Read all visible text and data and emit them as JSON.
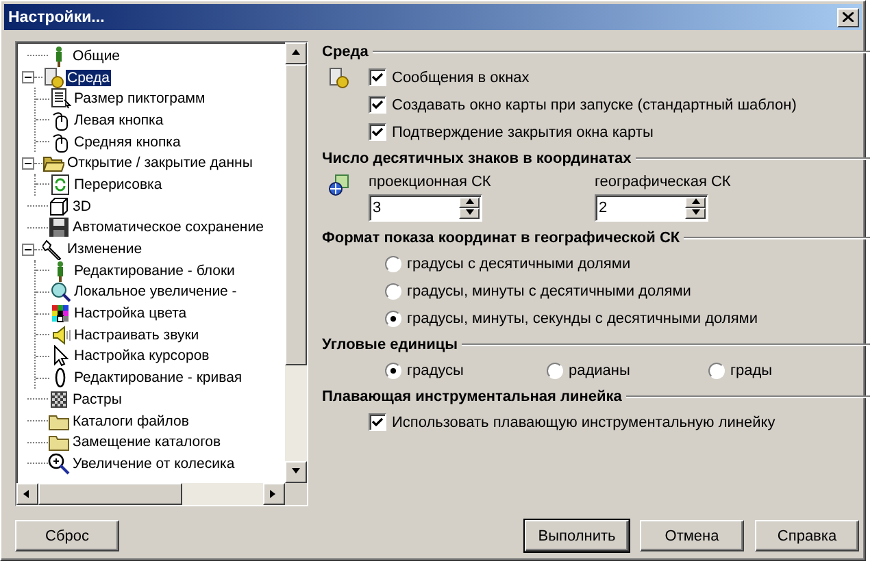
{
  "window": {
    "title": "Настройки..."
  },
  "tree": [
    {
      "label": "Общие",
      "kind": "figure",
      "selected": false
    },
    {
      "label": "Среда",
      "kind": "settings",
      "selected": true,
      "expanded": true,
      "children": [
        {
          "label": "Размер пиктограмм",
          "kind": "document",
          "selected": false
        },
        {
          "label": "Левая кнопка",
          "kind": "mouse",
          "selected": false
        },
        {
          "label": "Средняя кнопка",
          "kind": "mouse",
          "selected": false
        }
      ]
    },
    {
      "label": "Открытие / закрытие данны",
      "kind": "folder-open",
      "selected": false,
      "expanded": true,
      "children": [
        {
          "label": "Перерисовка",
          "kind": "refresh",
          "selected": false
        }
      ]
    },
    {
      "label": "3D",
      "kind": "cube",
      "selected": false
    },
    {
      "label": "Автоматическое сохранение",
      "kind": "floppy",
      "selected": false
    },
    {
      "label": "Изменение",
      "kind": "wrench",
      "selected": false,
      "expanded": true,
      "children": [
        {
          "label": "Редактирование - блоки",
          "kind": "figure",
          "selected": false
        },
        {
          "label": "Локальное увеличение -",
          "kind": "magnifier",
          "selected": false
        },
        {
          "label": "Настройка цвета",
          "kind": "palette",
          "selected": false
        },
        {
          "label": "Настраивать звуки",
          "kind": "speaker",
          "selected": false
        },
        {
          "label": "Настройка курсоров",
          "kind": "cursor",
          "selected": false
        },
        {
          "label": "Редактирование - кривая",
          "kind": "curve",
          "selected": false
        }
      ]
    },
    {
      "label": "Растры",
      "kind": "raster",
      "selected": false
    },
    {
      "label": "Каталоги файлов",
      "kind": "folder",
      "selected": false
    },
    {
      "label": "Замещение каталогов",
      "kind": "folder",
      "selected": false
    },
    {
      "label": "Увеличение от колесика",
      "kind": "zoom",
      "selected": false
    }
  ],
  "sections": [
    {
      "kind": "checks",
      "title": "Среда",
      "items": [
        {
          "label": "Сообщения в окнах",
          "checked": true
        },
        {
          "label": "Создавать окно карты при запуске (стандартный шаблон)",
          "checked": true
        },
        {
          "label": "Подтверждение закрытия окна карты",
          "checked": true
        }
      ]
    },
    {
      "kind": "spinners",
      "title": "Число десятичных знаков в координатах",
      "items": [
        {
          "label": "проекционная СК",
          "value": "3"
        },
        {
          "label": "географическая СК",
          "value": "2"
        }
      ]
    },
    {
      "kind": "radios",
      "title": "Формат показа координат в географической СК",
      "items": [
        {
          "label": "градусы с десятичными долями",
          "selected": false
        },
        {
          "label": "градусы, минуты с десятичными долями",
          "selected": false
        },
        {
          "label": "градусы, минуты, секунды с десятичными долями",
          "selected": true
        }
      ]
    },
    {
      "kind": "radios-row",
      "title": "Угловые единицы",
      "items": [
        {
          "label": "градусы",
          "selected": true
        },
        {
          "label": "радианы",
          "selected": false
        },
        {
          "label": "грады",
          "selected": false
        }
      ]
    },
    {
      "kind": "checks",
      "title": "Плавающая инструментальная линейка",
      "items": [
        {
          "label": "Использовать плавающую инструментальную линейку",
          "checked": true
        }
      ]
    }
  ],
  "buttons": [
    {
      "label": "Сброс",
      "default": false
    },
    {
      "label": "Выполнить",
      "default": true
    },
    {
      "label": "Отмена",
      "default": false
    },
    {
      "label": "Справка",
      "default": false
    }
  ]
}
